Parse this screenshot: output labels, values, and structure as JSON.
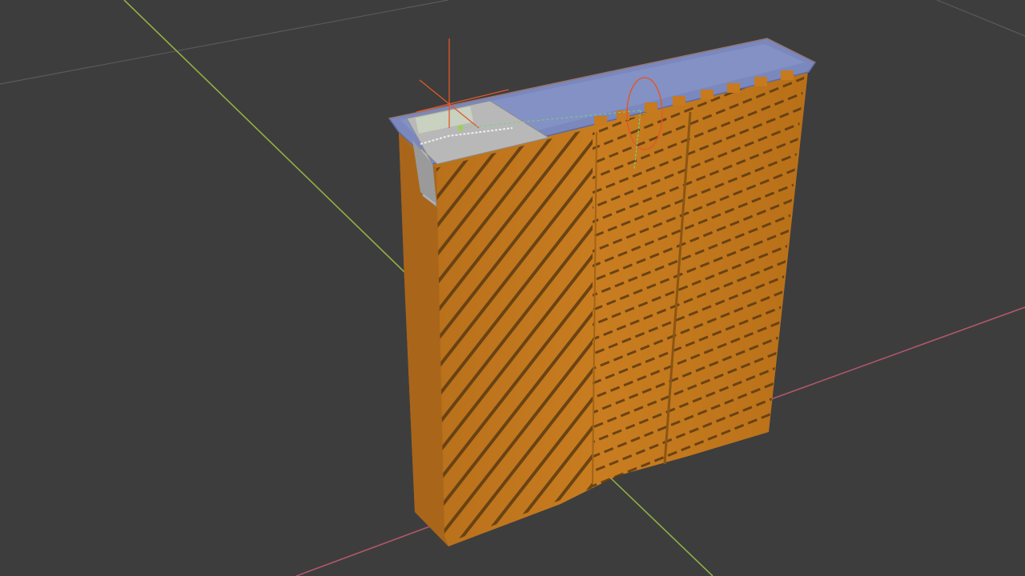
{
  "viewport": {
    "background": "#3d3d3d",
    "grid_line_color": "#4a4a4a",
    "axis_x_color": "#b0576a",
    "axis_y_color": "#8fb043",
    "object_body_color": "#c77a1e",
    "object_body_dark": "#8a5614",
    "object_top_color": "#7b88bd",
    "object_top_light": "#94a0cf",
    "selection_outline_color": "#e8822a",
    "cursor_color": "#e0582a",
    "gizmo_circle_color": "#e0582a",
    "gizmo_line_color": "#7ad07a",
    "inner_insert_color": "#b8b8b8",
    "icons": {
      "cursor": "3d-cursor-icon",
      "rotate_gizmo": "rotate-gizmo-icon"
    }
  }
}
